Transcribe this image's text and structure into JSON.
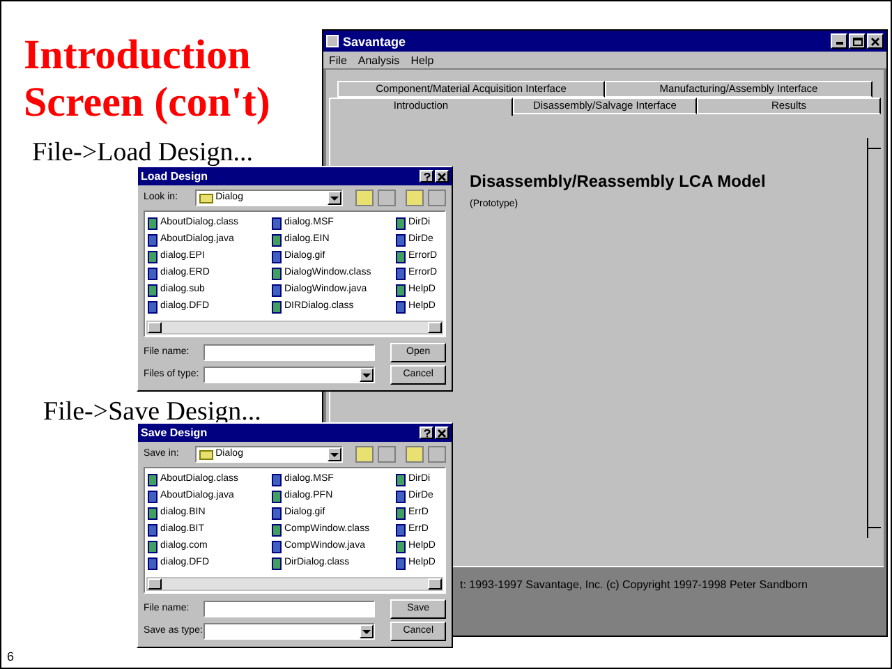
{
  "slide": {
    "title": "Introduction Screen (con't)",
    "captions": [
      "File->Load Design...",
      "File->Save Design..."
    ],
    "page_number": "6"
  },
  "app": {
    "title": "Savantage",
    "menu": [
      "File",
      "Analysis",
      "Help"
    ],
    "tab_rows": [
      [
        {
          "label": "Component/Material Acquisition Interface",
          "selected": false
        },
        {
          "label": "Manufacturing/Assembly Interface",
          "selected": false
        }
      ],
      [
        {
          "label": "Introduction",
          "selected": true
        },
        {
          "label": "Disassembly/Salvage Interface",
          "selected": false
        },
        {
          "label": "Results",
          "selected": false
        }
      ]
    ],
    "heading": "Disassembly/Reassembly LCA Model",
    "subheading": "(Prototype)",
    "status": "t: 1993-1997 Savantage, Inc.  (c) Copyright 1997-1998 Peter Sandborn"
  },
  "dialogs": [
    {
      "title": "Load Design",
      "look_in_label": "Look in:",
      "folder": "Dialog",
      "columns": [
        [
          "AboutDialog.class",
          "AboutDialog.java",
          "dialog.EPI",
          "dialog.ERD",
          "dialog.sub",
          "dialog.DFD"
        ],
        [
          "dialog.MSF",
          "dialog.EIN",
          "Dialog.gif",
          "DialogWindow.class",
          "DialogWindow.java",
          "DIRDialog.class"
        ],
        [
          "DirDi",
          "DirDe",
          "ErrorD",
          "ErrorD",
          "HelpD",
          "HelpD"
        ]
      ],
      "name_label": "File name:",
      "type_label": "Files of type:",
      "buttons": [
        "Open",
        "Cancel"
      ]
    },
    {
      "title": "Save Design",
      "look_in_label": "Save in:",
      "folder": "Dialog",
      "columns": [
        [
          "AboutDialog.class",
          "AboutDialog.java",
          "dialog.BIN",
          "dialog.BIT",
          "dialog.com",
          "dialog.DFD"
        ],
        [
          "dialog.MSF",
          "dialog.PFN",
          "Dialog.gif",
          "CompWindow.class",
          "CompWindow.java",
          "DirDialog.class"
        ],
        [
          "DirDi",
          "DirDe",
          "ErrD",
          "ErrD",
          "HelpD",
          "HelpD"
        ]
      ],
      "name_label": "File name:",
      "type_label": "Save as type:",
      "buttons": [
        "Save",
        "Cancel"
      ]
    }
  ]
}
